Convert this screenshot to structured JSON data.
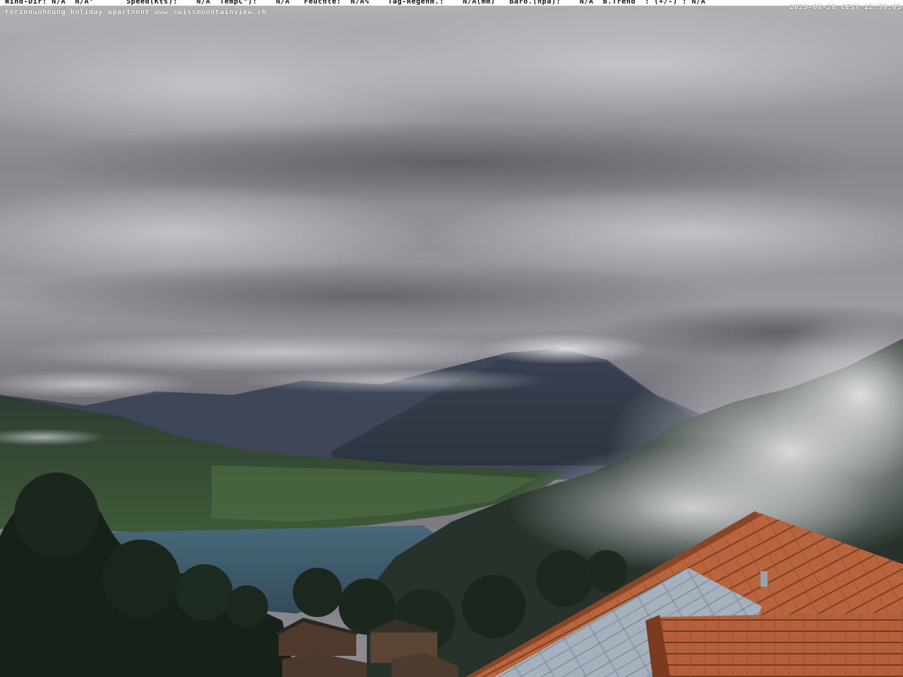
{
  "webcam": {
    "weather_line": {
      "wind_dir_label": "Wind-Dir:",
      "wind_dir_value": "N/A",
      "wind_deg_value": "N/A°",
      "speed_label": "Speed(Kts):",
      "speed_value": "N/A",
      "temp_label": "TempC°):",
      "temp_value": "N/A",
      "humidity_label": "Feuchte:",
      "humidity_value": "N/A%",
      "rain_label": "Tag-Regenm.:",
      "rain_value": "N/A(mm)",
      "baro_label": "Baro.(hpa):",
      "baro_value": "N/A",
      "trend_label": "B.Trend",
      "trend_value": ": (+/-) : N/A"
    },
    "caption": "Ferienwohnung holiday apartment www.swissmountainview.ch",
    "timestamp": "2025-08-28 CEST 12:59:03"
  },
  "colors": {
    "sky": "#8f8d93",
    "lake": "#3d5a6b",
    "roof": "#b5623c",
    "forest": "#1e2a1f"
  }
}
